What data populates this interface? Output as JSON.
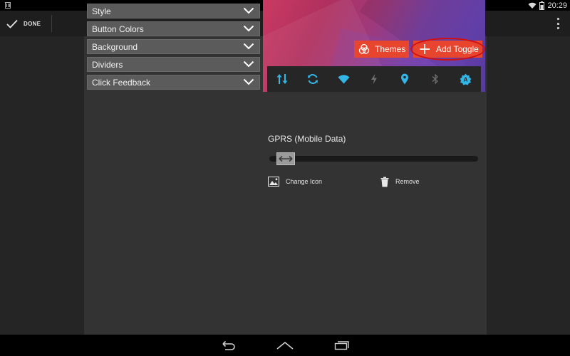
{
  "statusbar": {
    "time": "20:29",
    "icons": [
      "notification-icon",
      "wifi-icon",
      "battery-icon"
    ]
  },
  "actionbar": {
    "done_label": "DONE",
    "done_icon": "check-icon",
    "overflow_icon": "overflow-menu-icon"
  },
  "settings": {
    "dropdowns": [
      {
        "label": "Style"
      },
      {
        "label": "Button Colors"
      },
      {
        "label": "Background"
      },
      {
        "label": "Dividers"
      },
      {
        "label": "Click Feedback"
      }
    ]
  },
  "preview": {
    "themes_label": "Themes",
    "add_toggle_label": "Add Toggle",
    "accent_color": "#e8452f",
    "toggle_icon_color": "#33b5e5",
    "toggles": [
      {
        "icon": "mobile-data-icon",
        "active": true
      },
      {
        "icon": "sync-icon",
        "active": true
      },
      {
        "icon": "wifi-icon",
        "active": true
      },
      {
        "icon": "flash-icon",
        "active": false
      },
      {
        "icon": "location-icon",
        "active": true
      },
      {
        "icon": "bluetooth-icon",
        "active": false
      },
      {
        "icon": "auto-brightness-icon",
        "active": true
      }
    ]
  },
  "editor": {
    "toggle_name": "GPRS (Mobile Data)",
    "change_icon_label": "Change Icon",
    "remove_label": "Remove"
  },
  "navbar": {
    "icons": [
      "back-icon",
      "home-icon",
      "recents-icon"
    ]
  }
}
